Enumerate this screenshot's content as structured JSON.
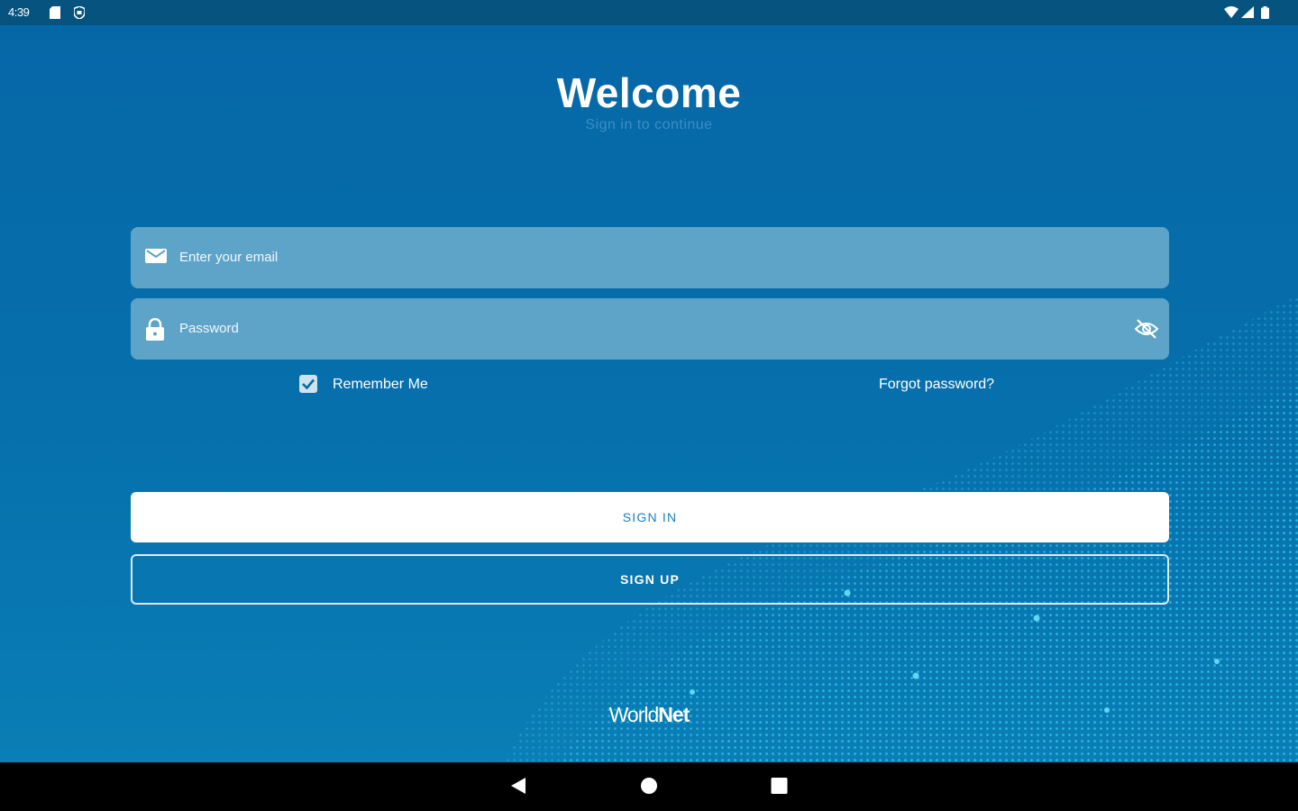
{
  "status_bar": {
    "time": "4:39",
    "left_icons": [
      "sd-card-icon",
      "shield-icon"
    ],
    "right_icons": [
      "wifi-icon",
      "signal-icon",
      "battery-icon"
    ]
  },
  "header": {
    "title": "Welcome",
    "subtitle": "Sign in to continue"
  },
  "form": {
    "email": {
      "placeholder": "Enter your email",
      "value": "",
      "icon": "mail-icon"
    },
    "password": {
      "placeholder": "Password",
      "value": "",
      "icon": "lock-icon",
      "toggle_icon": "eye-off-icon"
    },
    "remember_me": {
      "label": "Remember Me",
      "checked": true
    },
    "forgot_password": "Forgot password?"
  },
  "actions": {
    "sign_in": "SIGN IN",
    "sign_up": "SIGN UP"
  },
  "brand": {
    "logo_part1": "World",
    "logo_part2": "Net"
  },
  "nav_bar": {
    "buttons": [
      "back-icon",
      "home-icon",
      "recents-icon"
    ]
  },
  "colors": {
    "background": "#0668a8",
    "status_bar": "#06537f",
    "field_fill": "#5ea4c8",
    "accent_text": "#1a7fc4",
    "wave_dots": "#2fc1e8"
  }
}
